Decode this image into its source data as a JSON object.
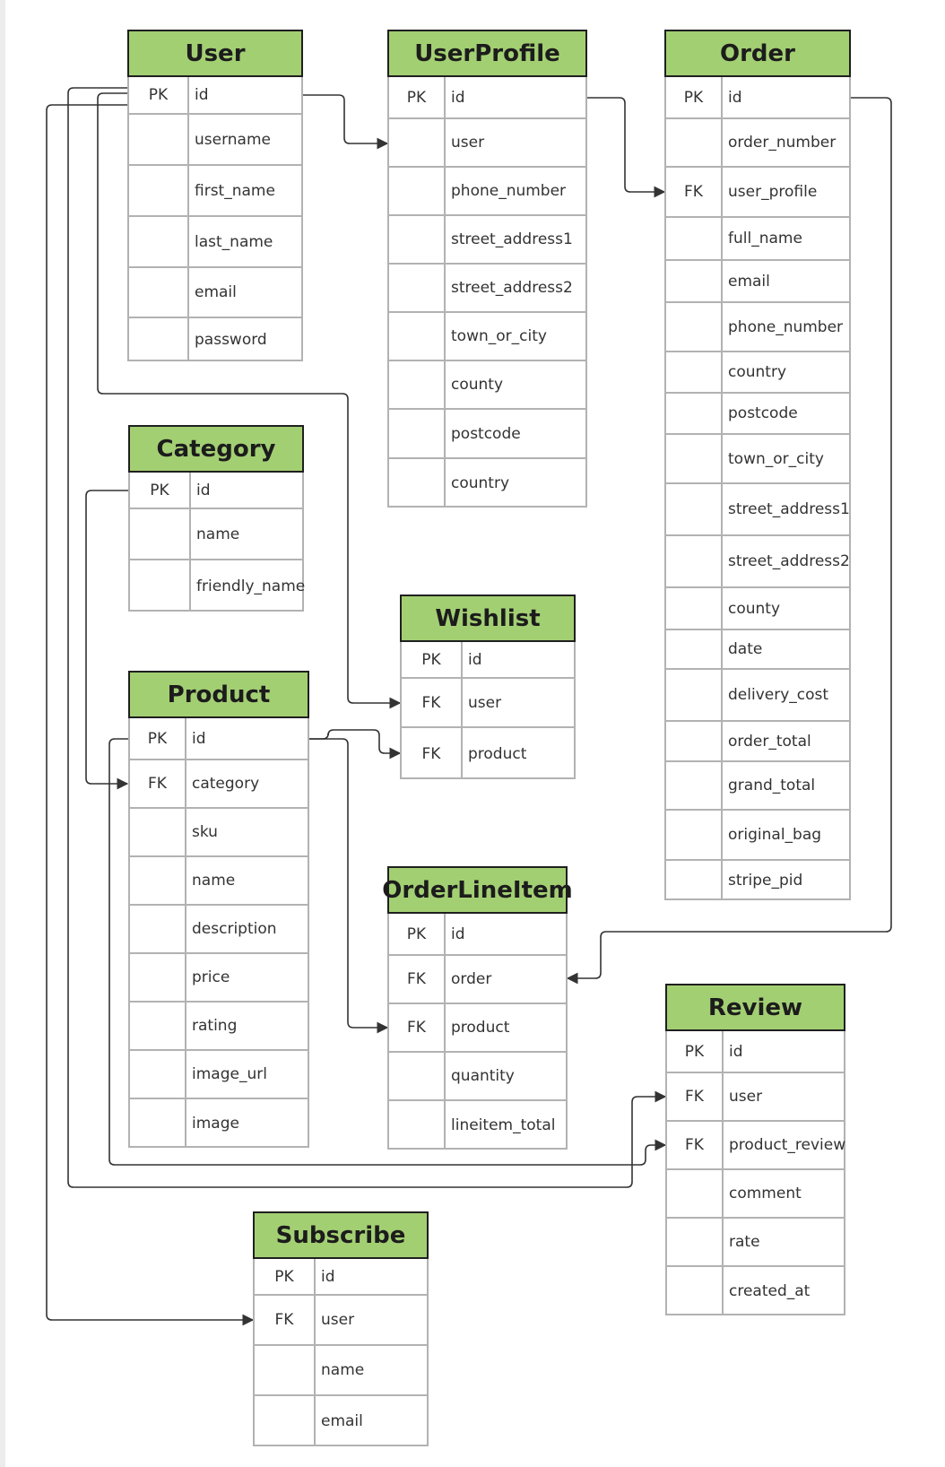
{
  "entities": [
    {
      "id": "user",
      "name": "User",
      "fields": [
        {
          "key": "PK",
          "name": "id"
        },
        {
          "key": "",
          "name": "username"
        },
        {
          "key": "",
          "name": "first_name"
        },
        {
          "key": "",
          "name": "last_name"
        },
        {
          "key": "",
          "name": "email"
        },
        {
          "key": "",
          "name": "password"
        }
      ]
    },
    {
      "id": "userprofile",
      "name": "UserProfile",
      "fields": [
        {
          "key": "PK",
          "name": "id"
        },
        {
          "key": "",
          "name": "user"
        },
        {
          "key": "",
          "name": "phone_number"
        },
        {
          "key": "",
          "name": "street_address1"
        },
        {
          "key": "",
          "name": "street_address2"
        },
        {
          "key": "",
          "name": "town_or_city"
        },
        {
          "key": "",
          "name": "county"
        },
        {
          "key": "",
          "name": "postcode"
        },
        {
          "key": "",
          "name": "country"
        }
      ]
    },
    {
      "id": "order",
      "name": "Order",
      "fields": [
        {
          "key": "PK",
          "name": "id"
        },
        {
          "key": "",
          "name": "order_number"
        },
        {
          "key": "FK",
          "name": "user_profile"
        },
        {
          "key": "",
          "name": "full_name"
        },
        {
          "key": "",
          "name": "email"
        },
        {
          "key": "",
          "name": "phone_number"
        },
        {
          "key": "",
          "name": "country"
        },
        {
          "key": "",
          "name": "postcode"
        },
        {
          "key": "",
          "name": "town_or_city"
        },
        {
          "key": "",
          "name": "street_address1"
        },
        {
          "key": "",
          "name": "street_address2"
        },
        {
          "key": "",
          "name": "county"
        },
        {
          "key": "",
          "name": "date"
        },
        {
          "key": "",
          "name": "delivery_cost"
        },
        {
          "key": "",
          "name": "order_total"
        },
        {
          "key": "",
          "name": "grand_total"
        },
        {
          "key": "",
          "name": "original_bag"
        },
        {
          "key": "",
          "name": "stripe_pid"
        }
      ]
    },
    {
      "id": "category",
      "name": "Category",
      "fields": [
        {
          "key": "PK",
          "name": "id"
        },
        {
          "key": "",
          "name": "name"
        },
        {
          "key": "",
          "name": "friendly_name"
        }
      ]
    },
    {
      "id": "wishlist",
      "name": "Wishlist",
      "fields": [
        {
          "key": "PK",
          "name": "id"
        },
        {
          "key": "FK",
          "name": "user"
        },
        {
          "key": "FK",
          "name": "product"
        }
      ]
    },
    {
      "id": "product",
      "name": "Product",
      "fields": [
        {
          "key": "PK",
          "name": "id"
        },
        {
          "key": "FK",
          "name": "category"
        },
        {
          "key": "",
          "name": "sku"
        },
        {
          "key": "",
          "name": "name"
        },
        {
          "key": "",
          "name": "description"
        },
        {
          "key": "",
          "name": "price"
        },
        {
          "key": "",
          "name": "rating"
        },
        {
          "key": "",
          "name": "image_url"
        },
        {
          "key": "",
          "name": "image"
        }
      ]
    },
    {
      "id": "orderlineitem",
      "name": "OrderLineItem",
      "fields": [
        {
          "key": "PK",
          "name": "id"
        },
        {
          "key": "FK",
          "name": "order"
        },
        {
          "key": "FK",
          "name": "product"
        },
        {
          "key": "",
          "name": "quantity"
        },
        {
          "key": "",
          "name": "lineitem_total"
        }
      ]
    },
    {
      "id": "review",
      "name": "Review",
      "fields": [
        {
          "key": "PK",
          "name": "id"
        },
        {
          "key": "FK",
          "name": "user"
        },
        {
          "key": "FK",
          "name": "product_review"
        },
        {
          "key": "",
          "name": "comment"
        },
        {
          "key": "",
          "name": "rate"
        },
        {
          "key": "",
          "name": "created_at"
        }
      ]
    },
    {
      "id": "subscribe",
      "name": "Subscribe",
      "fields": [
        {
          "key": "PK",
          "name": "id"
        },
        {
          "key": "FK",
          "name": "user"
        },
        {
          "key": "",
          "name": "name"
        },
        {
          "key": "",
          "name": "email"
        }
      ]
    }
  ],
  "relationships": [
    {
      "from": "User.id",
      "to": "UserProfile.user"
    },
    {
      "from": "UserProfile.id",
      "to": "Order.user_profile"
    },
    {
      "from": "User.id",
      "to": "Wishlist.user"
    },
    {
      "from": "Product.id",
      "to": "Wishlist.product"
    },
    {
      "from": "Category.id",
      "to": "Product.category"
    },
    {
      "from": "Order.id",
      "to": "OrderLineItem.order"
    },
    {
      "from": "Product.id",
      "to": "OrderLineItem.product"
    },
    {
      "from": "User.id",
      "to": "Review.user"
    },
    {
      "from": "Product.id",
      "to": "Review.product_review"
    },
    {
      "from": "User.id",
      "to": "Subscribe.user"
    }
  ],
  "colors": {
    "header_fill": "#a3cf73",
    "header_border": "#1f1f1f",
    "table_border": "#b2b2b2",
    "line": "#333333",
    "text": "#333333"
  }
}
